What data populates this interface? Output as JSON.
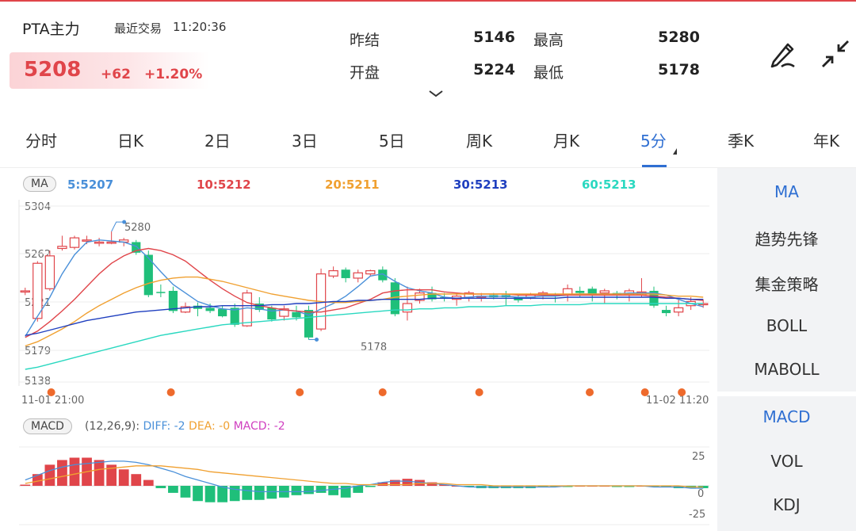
{
  "header": {
    "title": "PTA主力",
    "last_trade_label": "最近交易",
    "last_trade_time": "11:20:36",
    "price": "5208",
    "change": "+62",
    "change_pct": "+1.20%"
  },
  "stats": [
    {
      "label": "昨结",
      "value": "5146"
    },
    {
      "label": "最高",
      "value": "5280"
    },
    {
      "label": "开盘",
      "value": "5224"
    },
    {
      "label": "最低",
      "value": "5178"
    }
  ],
  "tabs": [
    "分时",
    "日K",
    "2日",
    "3日",
    "5日",
    "周K",
    "月K",
    "5分",
    "季K",
    "年K"
  ],
  "active_tab": "5分",
  "sidebar": {
    "main": [
      "MA",
      "趋势先锋",
      "集金策略",
      "BOLL",
      "MABOLL"
    ],
    "sub": [
      "MACD",
      "VOL",
      "KDJ"
    ]
  },
  "colors": {
    "up": "#e0454a",
    "down": "#1fbf7a",
    "accent": "#2f6fd2",
    "ma5": "#4a90d9",
    "ma10": "#e0454a",
    "ma20": "#f0a030",
    "ma30": "#1f3fbf",
    "ma60": "#2ad8c0",
    "dea": "#f0a030",
    "diff": "#4a90d9",
    "signal_dot": "#ee6a2c"
  },
  "chart_data": [
    {
      "type": "candlestick",
      "indicator_label": "MA",
      "ma_readouts": [
        "5:5207",
        "10:5212",
        "20:5211",
        "30:5213",
        "60:5213"
      ],
      "y_ticks": [
        "5304",
        "5262",
        "5221",
        "5179",
        "5138"
      ],
      "ylim": [
        5138,
        5304
      ],
      "high_mark": "5280",
      "low_mark": "5178",
      "x_start": "11-01 21:00",
      "x_end": "11-02 11:20",
      "candles": [
        [
          5224,
          5224,
          5227,
          5220
        ],
        [
          5198,
          5250,
          5252,
          5195
        ],
        [
          5226,
          5257,
          5262,
          5224
        ],
        [
          5264,
          5266,
          5276,
          5262
        ],
        [
          5265,
          5274,
          5276,
          5263
        ],
        [
          5272,
          5272,
          5276,
          5268
        ],
        [
          5270,
          5270,
          5274,
          5266
        ],
        [
          5270,
          5270,
          5280,
          5268
        ],
        [
          5270,
          5272,
          5274,
          5266
        ],
        [
          5270,
          5260,
          5272,
          5258
        ],
        [
          5258,
          5220,
          5262,
          5218
        ],
        [
          5223,
          5222,
          5230,
          5218
        ],
        [
          5224,
          5205,
          5228,
          5203
        ],
        [
          5204,
          5209,
          5213,
          5203
        ],
        [
          5210,
          5207,
          5213,
          5200
        ],
        [
          5208,
          5205,
          5212,
          5203
        ],
        [
          5207,
          5200,
          5210,
          5199
        ],
        [
          5208,
          5192,
          5212,
          5190
        ],
        [
          5191,
          5222,
          5225,
          5190
        ],
        [
          5212,
          5206,
          5218,
          5204
        ],
        [
          5208,
          5197,
          5210,
          5195
        ],
        [
          5200,
          5207,
          5210,
          5196
        ],
        [
          5204,
          5199,
          5210,
          5196
        ],
        [
          5206,
          5180,
          5210,
          5178
        ],
        [
          5188,
          5240,
          5245,
          5186
        ],
        [
          5238,
          5243,
          5247,
          5236
        ],
        [
          5244,
          5236,
          5246,
          5232
        ],
        [
          5236,
          5241,
          5244,
          5232
        ],
        [
          5240,
          5243,
          5244,
          5238
        ],
        [
          5244,
          5234,
          5247,
          5232
        ],
        [
          5232,
          5202,
          5236,
          5200
        ],
        [
          5204,
          5212,
          5228,
          5196
        ],
        [
          5215,
          5222,
          5226,
          5212
        ],
        [
          5222,
          5216,
          5228,
          5214
        ],
        [
          5218,
          5217,
          5222,
          5214
        ],
        [
          5216,
          5219,
          5222,
          5210
        ],
        [
          5218,
          5222,
          5224,
          5214
        ],
        [
          5219,
          5219,
          5222,
          5214
        ],
        [
          5220,
          5218,
          5222,
          5216
        ],
        [
          5220,
          5218,
          5224,
          5210
        ],
        [
          5218,
          5215,
          5220,
          5213
        ],
        [
          5218,
          5220,
          5222,
          5216
        ],
        [
          5220,
          5222,
          5224,
          5216
        ],
        [
          5220,
          5219,
          5222,
          5213
        ],
        [
          5220,
          5226,
          5230,
          5214
        ],
        [
          5224,
          5222,
          5228,
          5218
        ],
        [
          5226,
          5220,
          5228,
          5214
        ],
        [
          5222,
          5224,
          5226,
          5212
        ],
        [
          5222,
          5220,
          5224,
          5216
        ],
        [
          5220,
          5224,
          5226,
          5214
        ],
        [
          5220,
          5223,
          5236,
          5218
        ],
        [
          5224,
          5210,
          5228,
          5208
        ],
        [
          5206,
          5203,
          5210,
          5200
        ],
        [
          5204,
          5208,
          5216,
          5200
        ],
        [
          5210,
          5214,
          5218,
          5206
        ],
        [
          5212,
          5212,
          5216,
          5208
        ]
      ],
      "signal_markers": [
        7,
        33,
        61,
        79,
        100,
        124,
        136,
        144
      ],
      "ma": {
        "ma5": [
          5181,
          5200,
          5218,
          5240,
          5258,
          5270,
          5272,
          5271,
          5270,
          5266,
          5255,
          5242,
          5230,
          5222,
          5214,
          5210,
          5207,
          5206,
          5208,
          5207,
          5205,
          5206,
          5205,
          5201,
          5207,
          5212,
          5219,
          5228,
          5238,
          5240,
          5233,
          5227,
          5224,
          5222,
          5218,
          5217,
          5218,
          5219,
          5219,
          5219,
          5218,
          5218,
          5219,
          5219,
          5220,
          5221,
          5221,
          5221,
          5221,
          5222,
          5222,
          5222,
          5220,
          5216,
          5212,
          5209
        ],
        "ma10": [
          5180,
          5186,
          5195,
          5205,
          5216,
          5228,
          5240,
          5250,
          5257,
          5262,
          5264,
          5262,
          5258,
          5252,
          5243,
          5234,
          5226,
          5219,
          5213,
          5210,
          5208,
          5206,
          5205,
          5204,
          5204,
          5206,
          5208,
          5212,
          5216,
          5222,
          5224,
          5225,
          5225,
          5225,
          5223,
          5222,
          5221,
          5221,
          5221,
          5221,
          5220,
          5220,
          5220,
          5220,
          5220,
          5220,
          5220,
          5220,
          5220,
          5220,
          5220,
          5219,
          5218,
          5217,
          5216,
          5215
        ],
        "ma20": [
          5172,
          5176,
          5182,
          5188,
          5195,
          5203,
          5210,
          5216,
          5222,
          5227,
          5231,
          5234,
          5236,
          5237,
          5237,
          5235,
          5233,
          5230,
          5227,
          5224,
          5221,
          5219,
          5217,
          5215,
          5214,
          5213,
          5213,
          5214,
          5215,
          5216,
          5218,
          5219,
          5220,
          5221,
          5221,
          5221,
          5221,
          5221,
          5221,
          5221,
          5221,
          5221,
          5221,
          5221,
          5221,
          5221,
          5221,
          5221,
          5221,
          5221,
          5221,
          5221,
          5220,
          5219,
          5219,
          5218
        ],
        "ma30": [
          5182,
          5184,
          5187,
          5190,
          5193,
          5196,
          5198,
          5200,
          5202,
          5204,
          5205,
          5206,
          5207,
          5208,
          5209,
          5209,
          5210,
          5210,
          5210,
          5210,
          5211,
          5211,
          5212,
          5212,
          5213,
          5214,
          5214,
          5215,
          5215,
          5216,
          5216,
          5216,
          5216,
          5217,
          5217,
          5217,
          5217,
          5217,
          5217,
          5217,
          5217,
          5217,
          5217,
          5217,
          5218,
          5218,
          5218,
          5218,
          5218,
          5218,
          5218,
          5218,
          5217,
          5217,
          5216,
          5216
        ],
        "ma60": [
          5150,
          5152,
          5155,
          5158,
          5161,
          5164,
          5167,
          5170,
          5173,
          5176,
          5179,
          5182,
          5184,
          5186,
          5188,
          5190,
          5192,
          5193,
          5194,
          5195,
          5196,
          5197,
          5198,
          5199,
          5200,
          5201,
          5202,
          5203,
          5204,
          5205,
          5206,
          5206,
          5207,
          5207,
          5208,
          5208,
          5209,
          5209,
          5209,
          5210,
          5210,
          5210,
          5211,
          5211,
          5211,
          5211,
          5212,
          5212,
          5212,
          5212,
          5212,
          5212,
          5212,
          5212,
          5212,
          5212
        ]
      }
    },
    {
      "type": "bar",
      "indicator_label": "MACD",
      "params": "(12,26,9):",
      "diff_label": "DIFF: -2",
      "dea_label": "DEA: -0",
      "macd_label": "MACD: -2",
      "y_ticks": [
        "25",
        "0",
        "-25"
      ],
      "ylim": [
        -25,
        25
      ],
      "hist": [
        1,
        10,
        18,
        22,
        24,
        24,
        22,
        18,
        14,
        10,
        5,
        -2,
        -6,
        -10,
        -13,
        -14,
        -14,
        -13,
        -12,
        -12,
        -11,
        -10,
        -8,
        -7,
        -6,
        -8,
        -10,
        -6,
        -1,
        3,
        5,
        6,
        5,
        3,
        1,
        0,
        -1,
        -2,
        -2,
        -2,
        -2,
        -2,
        -1,
        -1,
        -1,
        0,
        0,
        0,
        -1,
        -1,
        0,
        -1,
        -1,
        -2,
        -2,
        -2
      ],
      "diff": [
        5,
        9,
        13,
        16,
        18,
        19,
        20,
        21,
        21,
        20,
        18,
        15,
        12,
        8,
        5,
        2,
        -1,
        -3,
        -4,
        -5,
        -5,
        -5,
        -5,
        -5,
        -4,
        -3,
        -2,
        0,
        1,
        3,
        4,
        4,
        3,
        2,
        1,
        0,
        -1,
        -1,
        -1,
        -1,
        -1,
        -1,
        -1,
        -1,
        0,
        0,
        0,
        0,
        0,
        0,
        0,
        -1,
        -1,
        -1,
        -2,
        -2
      ],
      "dea": [
        2,
        4,
        6,
        8,
        10,
        12,
        14,
        15,
        16,
        17,
        17,
        17,
        16,
        15,
        14,
        12,
        11,
        10,
        9,
        8,
        7,
        6,
        5,
        4,
        3,
        2,
        2,
        1,
        1,
        1,
        1,
        1,
        2,
        2,
        2,
        1,
        1,
        1,
        0,
        0,
        0,
        0,
        0,
        0,
        0,
        0,
        0,
        0,
        0,
        0,
        0,
        0,
        0,
        0,
        -1,
        -1
      ]
    }
  ]
}
